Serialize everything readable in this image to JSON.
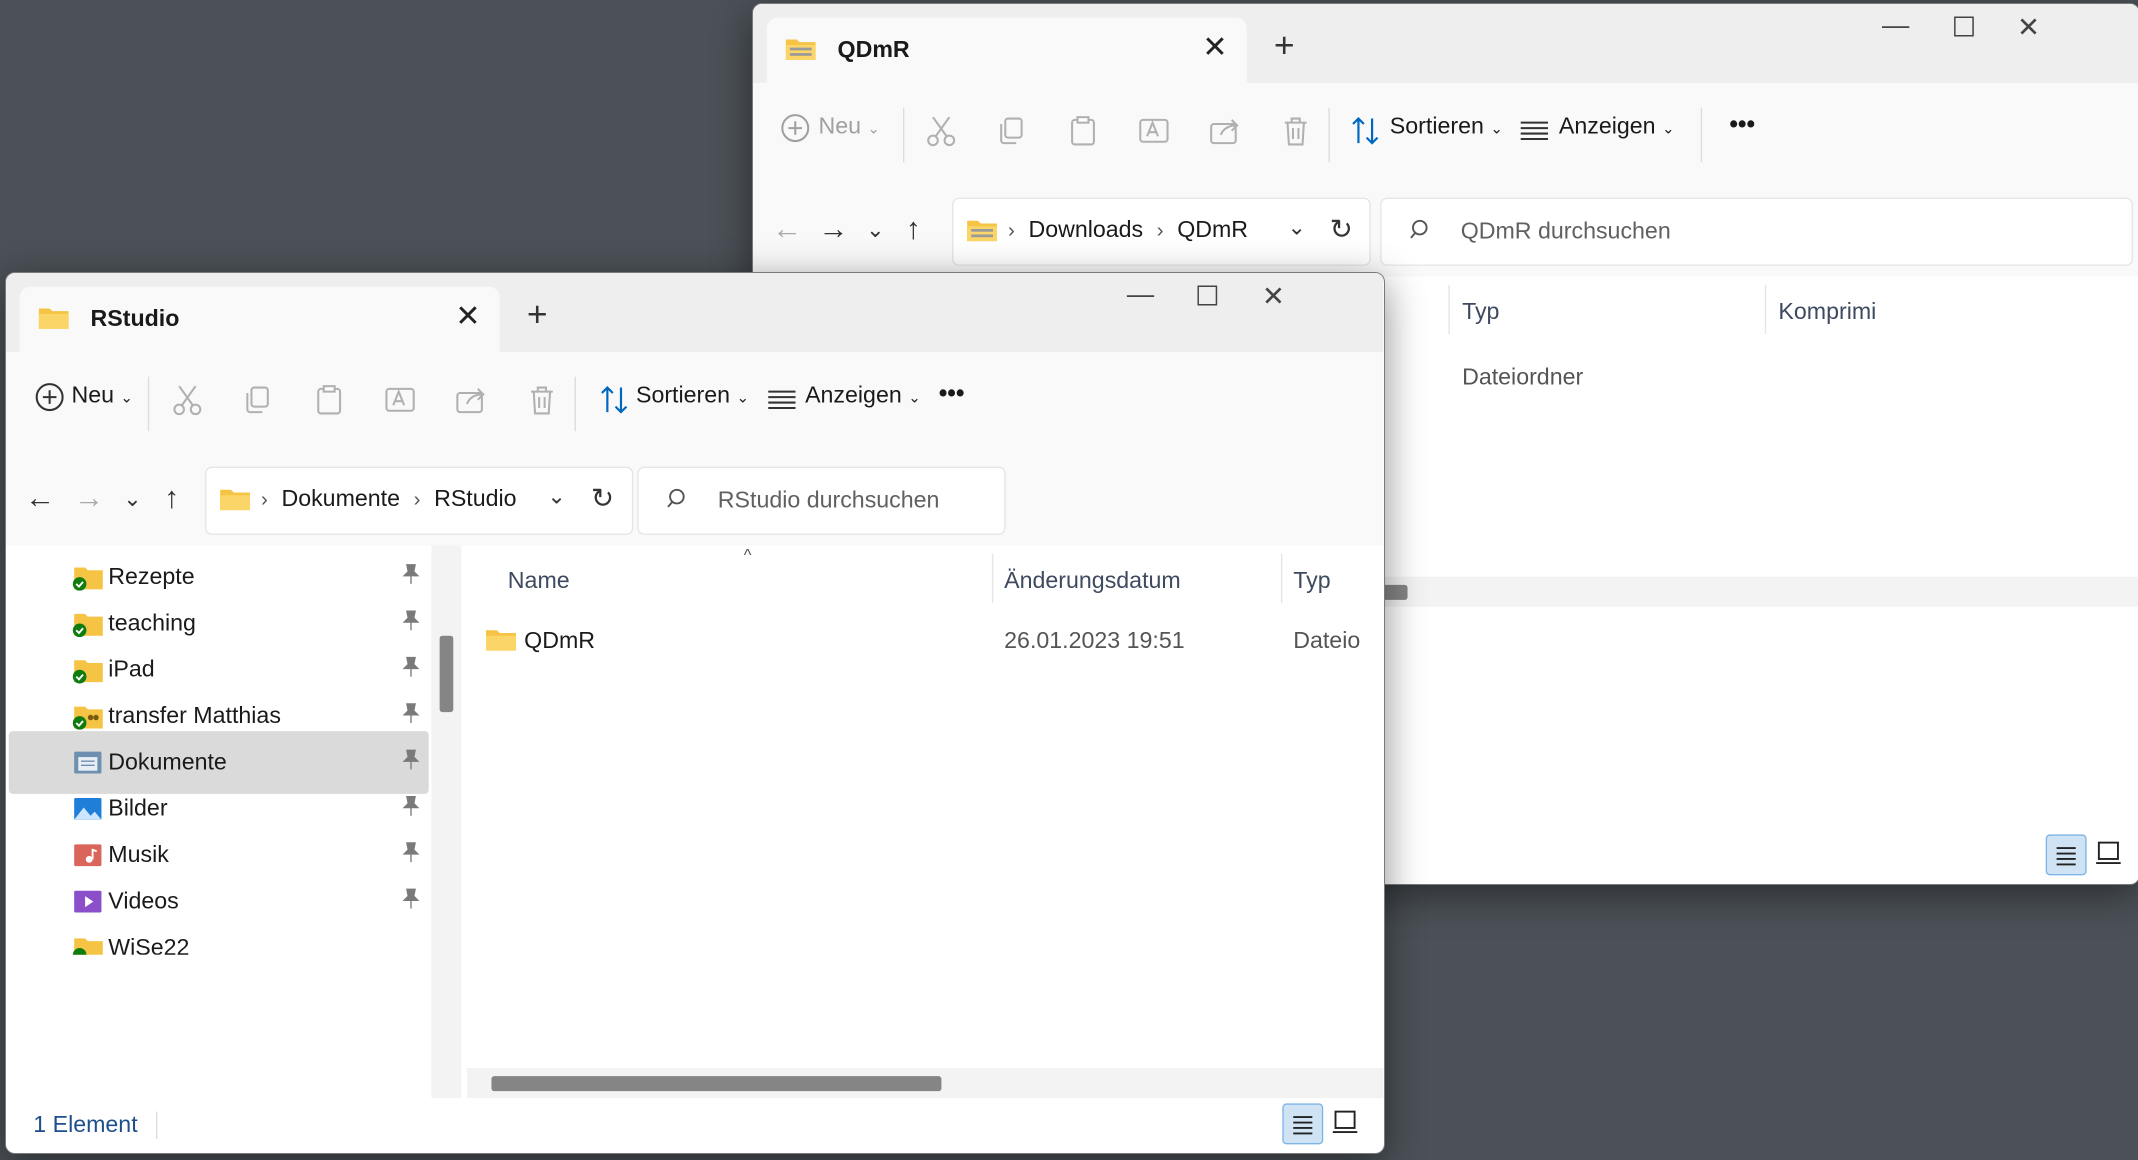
{
  "back_window": {
    "tab_title": "QDmR",
    "toolbar": {
      "new_label": "Neu",
      "sort_label": "Sortieren",
      "view_label": "Anzeigen",
      "more": "•••"
    },
    "breadcrumb": [
      "Downloads",
      "QDmR"
    ],
    "search_placeholder": "QDmR durchsuchen",
    "columns": {
      "type": "Typ",
      "compressed": "Komprimi"
    },
    "row": {
      "type": "Dateiordner"
    }
  },
  "front_window": {
    "tab_title": "RStudio",
    "toolbar": {
      "new_label": "Neu",
      "sort_label": "Sortieren",
      "view_label": "Anzeigen",
      "more": "•••"
    },
    "breadcrumb": [
      "Dokumente",
      "RStudio"
    ],
    "search_placeholder": "RStudio durchsuchen",
    "sidebar": {
      "items": [
        {
          "label": "Rezepte",
          "icon": "folder-synced-icon"
        },
        {
          "label": "teaching",
          "icon": "folder-synced-icon"
        },
        {
          "label": "iPad",
          "icon": "folder-synced-icon"
        },
        {
          "label": "transfer Matthias",
          "icon": "folder-shared-synced-icon"
        },
        {
          "label": "Dokumente",
          "icon": "documents-icon",
          "selected": true
        },
        {
          "label": "Bilder",
          "icon": "pictures-icon"
        },
        {
          "label": "Musik",
          "icon": "music-icon"
        },
        {
          "label": "Videos",
          "icon": "videos-icon"
        },
        {
          "label": "WiSe22",
          "icon": "folder-synced-icon"
        }
      ]
    },
    "columns": {
      "name": "Name",
      "date": "Änderungsdatum",
      "type": "Typ"
    },
    "rows": [
      {
        "name": "QDmR",
        "date": "26.01.2023 19:51",
        "type": "Dateio"
      }
    ],
    "status": "1 Element"
  },
  "colors": {
    "desktop": "#4b5157",
    "accent": "#0067c0",
    "folder": "#f6c445",
    "selected_item": "#dadada"
  }
}
